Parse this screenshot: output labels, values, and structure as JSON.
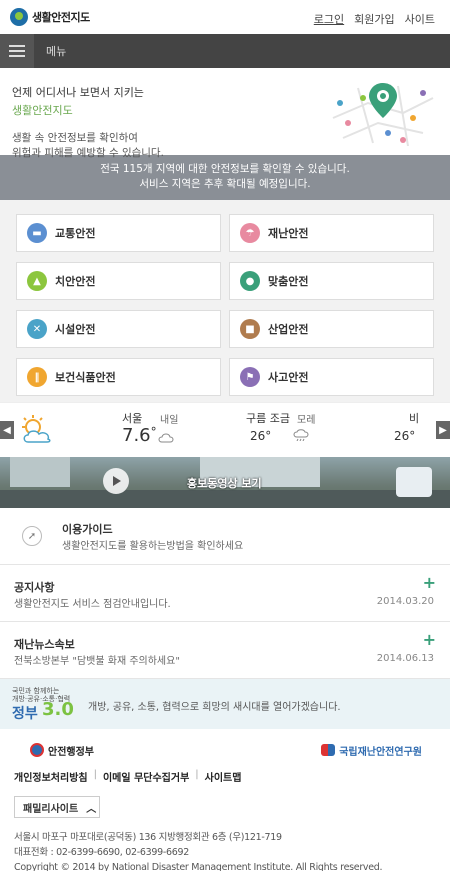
{
  "header": {
    "logo_text": "생활안전지도",
    "links": [
      "로그인",
      "회원가입",
      "사이트"
    ]
  },
  "menu": {
    "label": "메뉴"
  },
  "intro": {
    "line1": "언제 어디서나 보면서 지키는",
    "line2": "생활안전지도",
    "desc1": "생활 속 안전정보를 확인하여",
    "desc2": "위험과 피해를 예방할 수 있습니다."
  },
  "notice": {
    "line1": "전국 115개 지역에 대한 안전정보를 확인할 수 있습니다.",
    "line2": "서비스 지역은 추후 확대될 예정입니다."
  },
  "categories": [
    {
      "label": "교통안전",
      "color": "#5b8fd1",
      "icon": "car-icon"
    },
    {
      "label": "재난안전",
      "color": "#e88aa0",
      "icon": "umbrella-icon"
    },
    {
      "label": "치안안전",
      "color": "#8cc63e",
      "icon": "bell-icon"
    },
    {
      "label": "맞춤안전",
      "color": "#3aa07a",
      "icon": "person-icon"
    },
    {
      "label": "시설안전",
      "color": "#4aa3c8",
      "icon": "wrench-icon"
    },
    {
      "label": "산업안전",
      "color": "#b07c4e",
      "icon": "factory-icon"
    },
    {
      "label": "보건식품안전",
      "color": "#f0a630",
      "icon": "utensils-icon"
    },
    {
      "label": "사고안전",
      "color": "#8a6fb5",
      "icon": "flag-icon"
    }
  ],
  "weather": {
    "city": "서울",
    "today_temp": "7.6",
    "today_unit": "°",
    "tomorrow_label": "내일",
    "cond1": "구름 조금",
    "temp1": "26°",
    "label2": "모레",
    "cond2": "비",
    "temp2": "26°"
  },
  "video": {
    "label": "홍보동영상 보기"
  },
  "guide": {
    "title": "이용가이드",
    "desc": "생활안전지도를 활용하는방법을 확인하세요"
  },
  "notice_board": {
    "title": "공지사항",
    "item": "생활안전지도 서비스 점검안내입니다.",
    "date": "2014.03.20"
  },
  "disaster_news": {
    "title": "재난뉴스속보",
    "item": "전북소방본부 \"담뱃불 화재 주의하세요\"",
    "date": "2014.06.13"
  },
  "gov_banner": {
    "logo_small1": "국민과 함께하는",
    "logo_small2": "개방·공유·소통·협력",
    "logo_big": "정부",
    "logo_num": "3.0",
    "text": "개방, 공유, 소통, 협력으로 희망의 새시대를 열어가겠습니다."
  },
  "footer": {
    "partner1": "안전행정부",
    "partner2": "국립재난안전연구원",
    "links": [
      "개인정보처리방침",
      "이메일 무단수집거부",
      "사이트맵"
    ],
    "family_site": "패밀리사이트",
    "address": "서울시 마포구 마포대로(공덕동) 136 지방행정회관 6층 (우)121-719",
    "phone": "대표전화 : 02-6399-6690, 02-6399-6692",
    "copyright": "Copyright © 2014 by National Disaster Management Institute. All Rights reserved."
  }
}
